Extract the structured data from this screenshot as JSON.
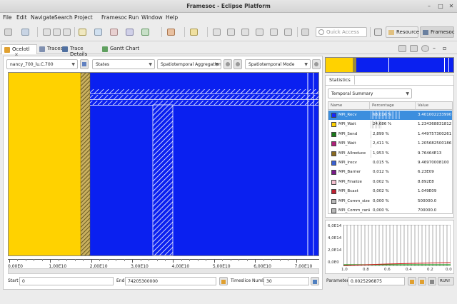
{
  "window": {
    "title": "Framesoc - Eclipse Platform"
  },
  "menu": [
    "File",
    "Edit",
    "Navigate",
    "Search",
    "Project",
    "Framesoc",
    "Run",
    "Window",
    "Help"
  ],
  "toolbar": {
    "quick_access_placeholder": "Quick Access",
    "perspectives": [
      "Resource",
      "Framesoc"
    ]
  },
  "tabs": [
    {
      "label": "Ocelotl",
      "active": true
    },
    {
      "label": "Traces",
      "active": false
    },
    {
      "label": "Trace Details",
      "active": false
    },
    {
      "label": "Gantt Chart",
      "active": false
    }
  ],
  "ocelotl": {
    "trace_combo": "nancy_700_lu.C.700",
    "metric_combo": "States",
    "aggregation_combo": "Spatiotemporal Aggregation",
    "mode_combo": "Spatiotemporal Mode",
    "axis_ticks": [
      "0,00E0",
      "1,00E10",
      "2,00E10",
      "3,00E10",
      "4,00E10",
      "5,00E10",
      "6,00E10",
      "7,00E10"
    ],
    "start_label": "Start",
    "start_value": "0",
    "end_label": "End",
    "end_value": "74205300000",
    "timeslice_label": "Timeslice Number",
    "timeslice_value": "30",
    "colors": {
      "wait": "#ffd200",
      "recv": "#0a20f0",
      "stripe": "#9c8a3a"
    }
  },
  "statistics": {
    "tab_label": "Statistics",
    "summary_combo": "Temporal Summary",
    "columns": [
      "Name",
      "Percentage",
      "Value"
    ],
    "rows": [
      {
        "name": "MPI_Recv",
        "pct": "68,016 %",
        "pct_num": 68.016,
        "value": "3.401002233990",
        "color": "#1428ff",
        "selected": true
      },
      {
        "name": "MPI_Wait",
        "pct": "24,686 %",
        "pct_num": 24.686,
        "value": "1.234368831812",
        "color": "#ffd200",
        "selected": false
      },
      {
        "name": "MPI_Send",
        "pct": "2,899 %",
        "pct_num": 2.899,
        "value": "1.449757300261",
        "color": "#1a7a1a",
        "selected": false
      },
      {
        "name": "MPI_Wait",
        "pct": "2,411 %",
        "pct_num": 2.411,
        "value": "1.205682500186",
        "color": "#b0207a",
        "selected": false
      },
      {
        "name": "MPI_Allreduce",
        "pct": "1,953 %",
        "pct_num": 1.953,
        "value": "9.76464E13",
        "color": "#8a6a20",
        "selected": false
      },
      {
        "name": "MPI_Irecv",
        "pct": "0,015 %",
        "pct_num": 0.015,
        "value": "9.46970008100",
        "color": "#3a60d0",
        "selected": false
      },
      {
        "name": "MPI_Barrier",
        "pct": "0,012 %",
        "pct_num": 0.012,
        "value": "6.23E09",
        "color": "#7a1a8a",
        "selected": false
      },
      {
        "name": "MPI_Finalize",
        "pct": "0,002 %",
        "pct_num": 0.002,
        "value": "8.892E8",
        "color": "#f5c0d0",
        "selected": false
      },
      {
        "name": "MPI_Bcast",
        "pct": "0,002 %",
        "pct_num": 0.002,
        "value": "1.049E09",
        "color": "#c02030",
        "selected": false
      },
      {
        "name": "MPI_Comm_size",
        "pct": "0,000 %",
        "pct_num": 0.0,
        "value": "500000.0",
        "color": "#b8b8b8",
        "selected": false
      },
      {
        "name": "MPI_Comm_rank",
        "pct": "0,000 %",
        "pct_num": 0.0,
        "value": "700000.0",
        "color": "#b8b8b8",
        "selected": false
      }
    ]
  },
  "histogram": {
    "y_labels": [
      "6,0E14",
      "4,0E14",
      "2,0E14",
      "0,0E0"
    ],
    "x_labels": [
      "1.0",
      "0.8",
      "0.6",
      "0.4",
      "0.2",
      "0.0"
    ]
  },
  "params": {
    "parameter_label": "Parameter",
    "parameter_value": "0.0025296875",
    "run_label": "RUN!"
  }
}
